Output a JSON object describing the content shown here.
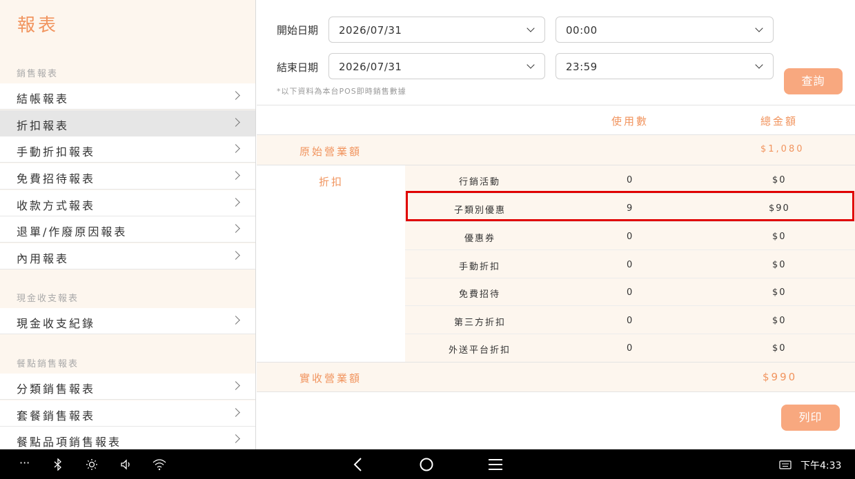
{
  "sidebar": {
    "title": "報表",
    "sections": [
      {
        "label": "銷售報表"
      },
      {
        "label": "現金收支報表"
      },
      {
        "label": "餐點銷售報表"
      }
    ],
    "items": [
      {
        "label": "結帳報表"
      },
      {
        "label": "折扣報表",
        "active": true
      },
      {
        "label": "手動折扣報表"
      },
      {
        "label": "免費招待報表"
      },
      {
        "label": "收款方式報表"
      },
      {
        "label": "退單/作廢原因報表"
      },
      {
        "label": "內用報表"
      },
      {
        "label": "現金收支紀錄"
      },
      {
        "label": "分類銷售報表"
      },
      {
        "label": "套餐銷售報表"
      },
      {
        "label": "餐點品項銷售報表"
      }
    ]
  },
  "filters": {
    "start_label": "開始日期",
    "end_label": "結束日期",
    "start_date": "2026/07/31",
    "start_time": "00:00",
    "end_date": "2026/07/31",
    "end_time": "23:59",
    "note": "*以下資料為本台POS即時銷售數據",
    "query_button": "查詢"
  },
  "table": {
    "col_count": "使用數",
    "col_amount": "總金額",
    "gross_label": "原始營業額",
    "gross_amount": "$1,080",
    "discount_label": "折扣",
    "rows": [
      {
        "name": "行銷活動",
        "count": "0",
        "amount": "$0"
      },
      {
        "name": "子類別優惠",
        "count": "9",
        "amount": "$90"
      },
      {
        "name": "優惠券",
        "count": "0",
        "amount": "$0"
      },
      {
        "name": "手動折扣",
        "count": "0",
        "amount": "$0"
      },
      {
        "name": "免費招待",
        "count": "0",
        "amount": "$0"
      },
      {
        "name": "第三方折扣",
        "count": "0",
        "amount": "$0"
      },
      {
        "name": "外送平台折扣",
        "count": "0",
        "amount": "$0"
      }
    ],
    "net_label": "實收營業額",
    "net_amount": "$990"
  },
  "print_button": "列印",
  "statusbar": {
    "time": "下午4:33",
    "icons": [
      "more-icon",
      "bluetooth-icon",
      "brightness-icon",
      "volume-icon",
      "wifi-icon",
      "back-icon",
      "home-icon",
      "menu-icon",
      "keyboard-icon"
    ]
  }
}
